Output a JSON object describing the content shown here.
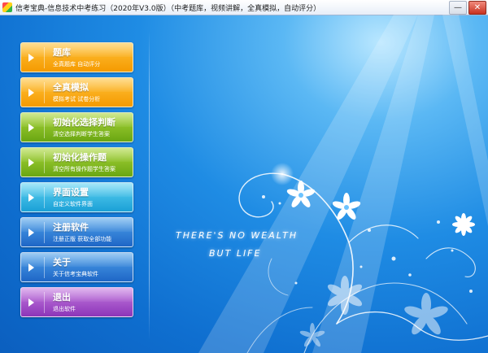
{
  "window": {
    "title": "信考宝典-信息技术中考练习（2020年V3.0版）（中考题库，视频讲解，全真模拟，自动评分）",
    "minimize_glyph": "—",
    "close_glyph": "✕"
  },
  "menu": [
    {
      "label": "题库",
      "sub": "全真题库 自动评分",
      "color": "orange"
    },
    {
      "label": "全真模拟",
      "sub": "模拟考试 试卷分析",
      "color": "orange"
    },
    {
      "label": "初始化选择判断",
      "sub": "清空选择判断学生答案",
      "color": "green"
    },
    {
      "label": "初始化操作题",
      "sub": "清空所有操作题学生答案",
      "color": "green"
    },
    {
      "label": "界面设置",
      "sub": "自定义软件界面",
      "color": "cyan"
    },
    {
      "label": "注册软件",
      "sub": "注册正版 获取全部功能",
      "color": "blue"
    },
    {
      "label": "关于",
      "sub": "关于信考宝典软件",
      "color": "blue"
    },
    {
      "label": "退出",
      "sub": "退出软件",
      "color": "purple"
    }
  ],
  "slogan": {
    "line1": "THERE'S NO WEALTH",
    "line2": "BUT LIFE"
  },
  "colors": {
    "orange": "#f8ac14",
    "green": "#86bd22",
    "cyan": "#36b9e6",
    "blue": "#2f7fd8",
    "purple": "#a555cc"
  }
}
